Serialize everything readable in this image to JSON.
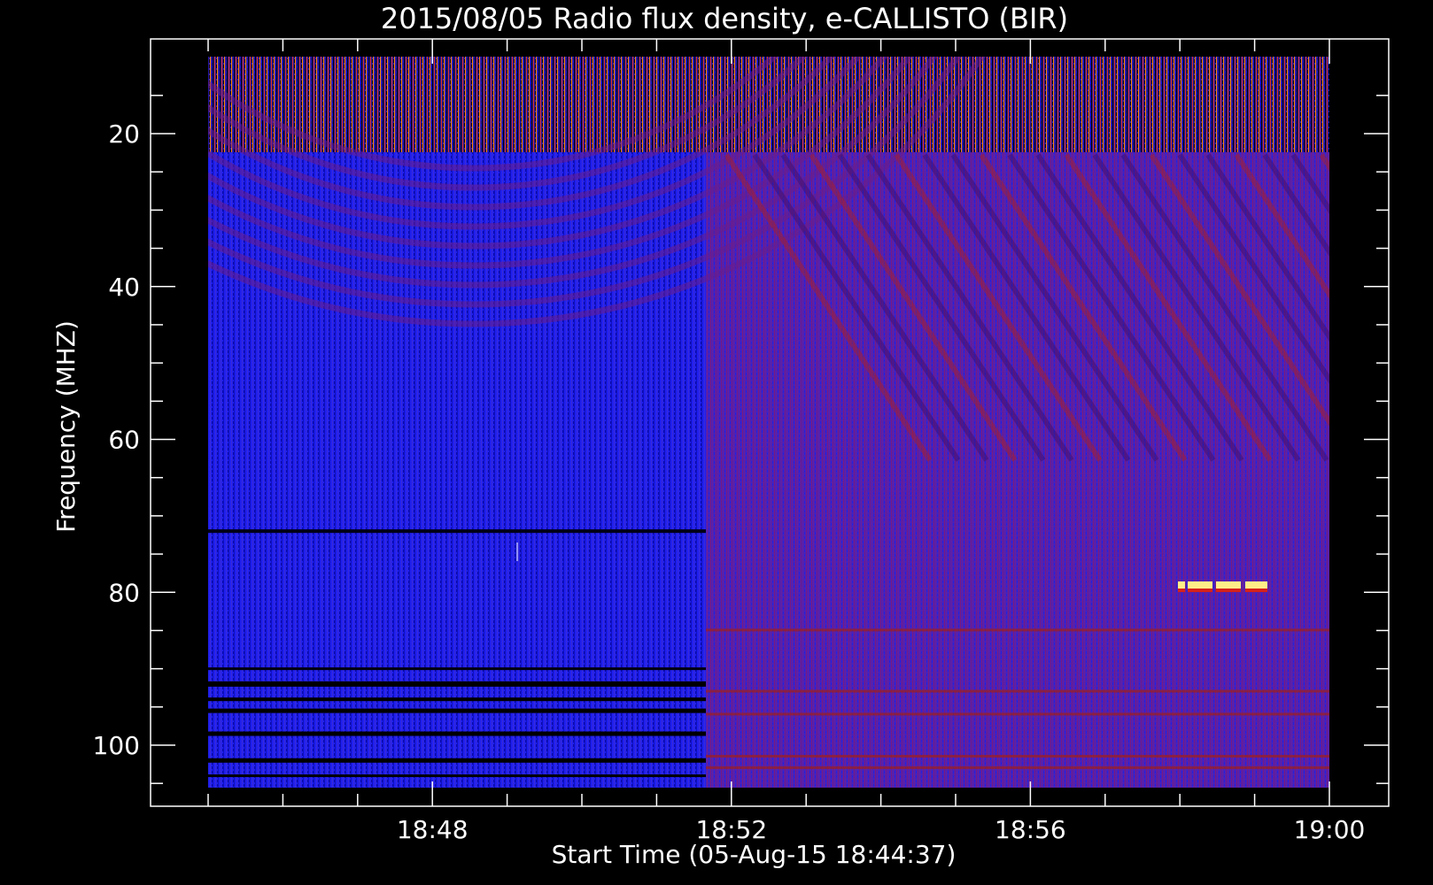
{
  "chart_data": {
    "type": "heatmap",
    "title": "2015/08/05  Radio flux density, e-CALLISTO (BIR)",
    "xlabel": "Start Time (05-Aug-15 18:44:37)",
    "ylabel": "Frequency (MHZ)",
    "x_ticks": [
      "18:48",
      "18:52",
      "18:56",
      "19:00"
    ],
    "y_ticks": [
      "20",
      "40",
      "60",
      "80",
      "100"
    ],
    "x_range": [
      "18:44:37",
      "19:00:00"
    ],
    "y_range": [
      10,
      105
    ],
    "y_axis_inverted": true,
    "colors": {
      "background": "#000000",
      "low": "#1a1aff",
      "mid": "#5a1aa8",
      "high": "#cc1a1a",
      "peak": "#ffee88"
    }
  }
}
